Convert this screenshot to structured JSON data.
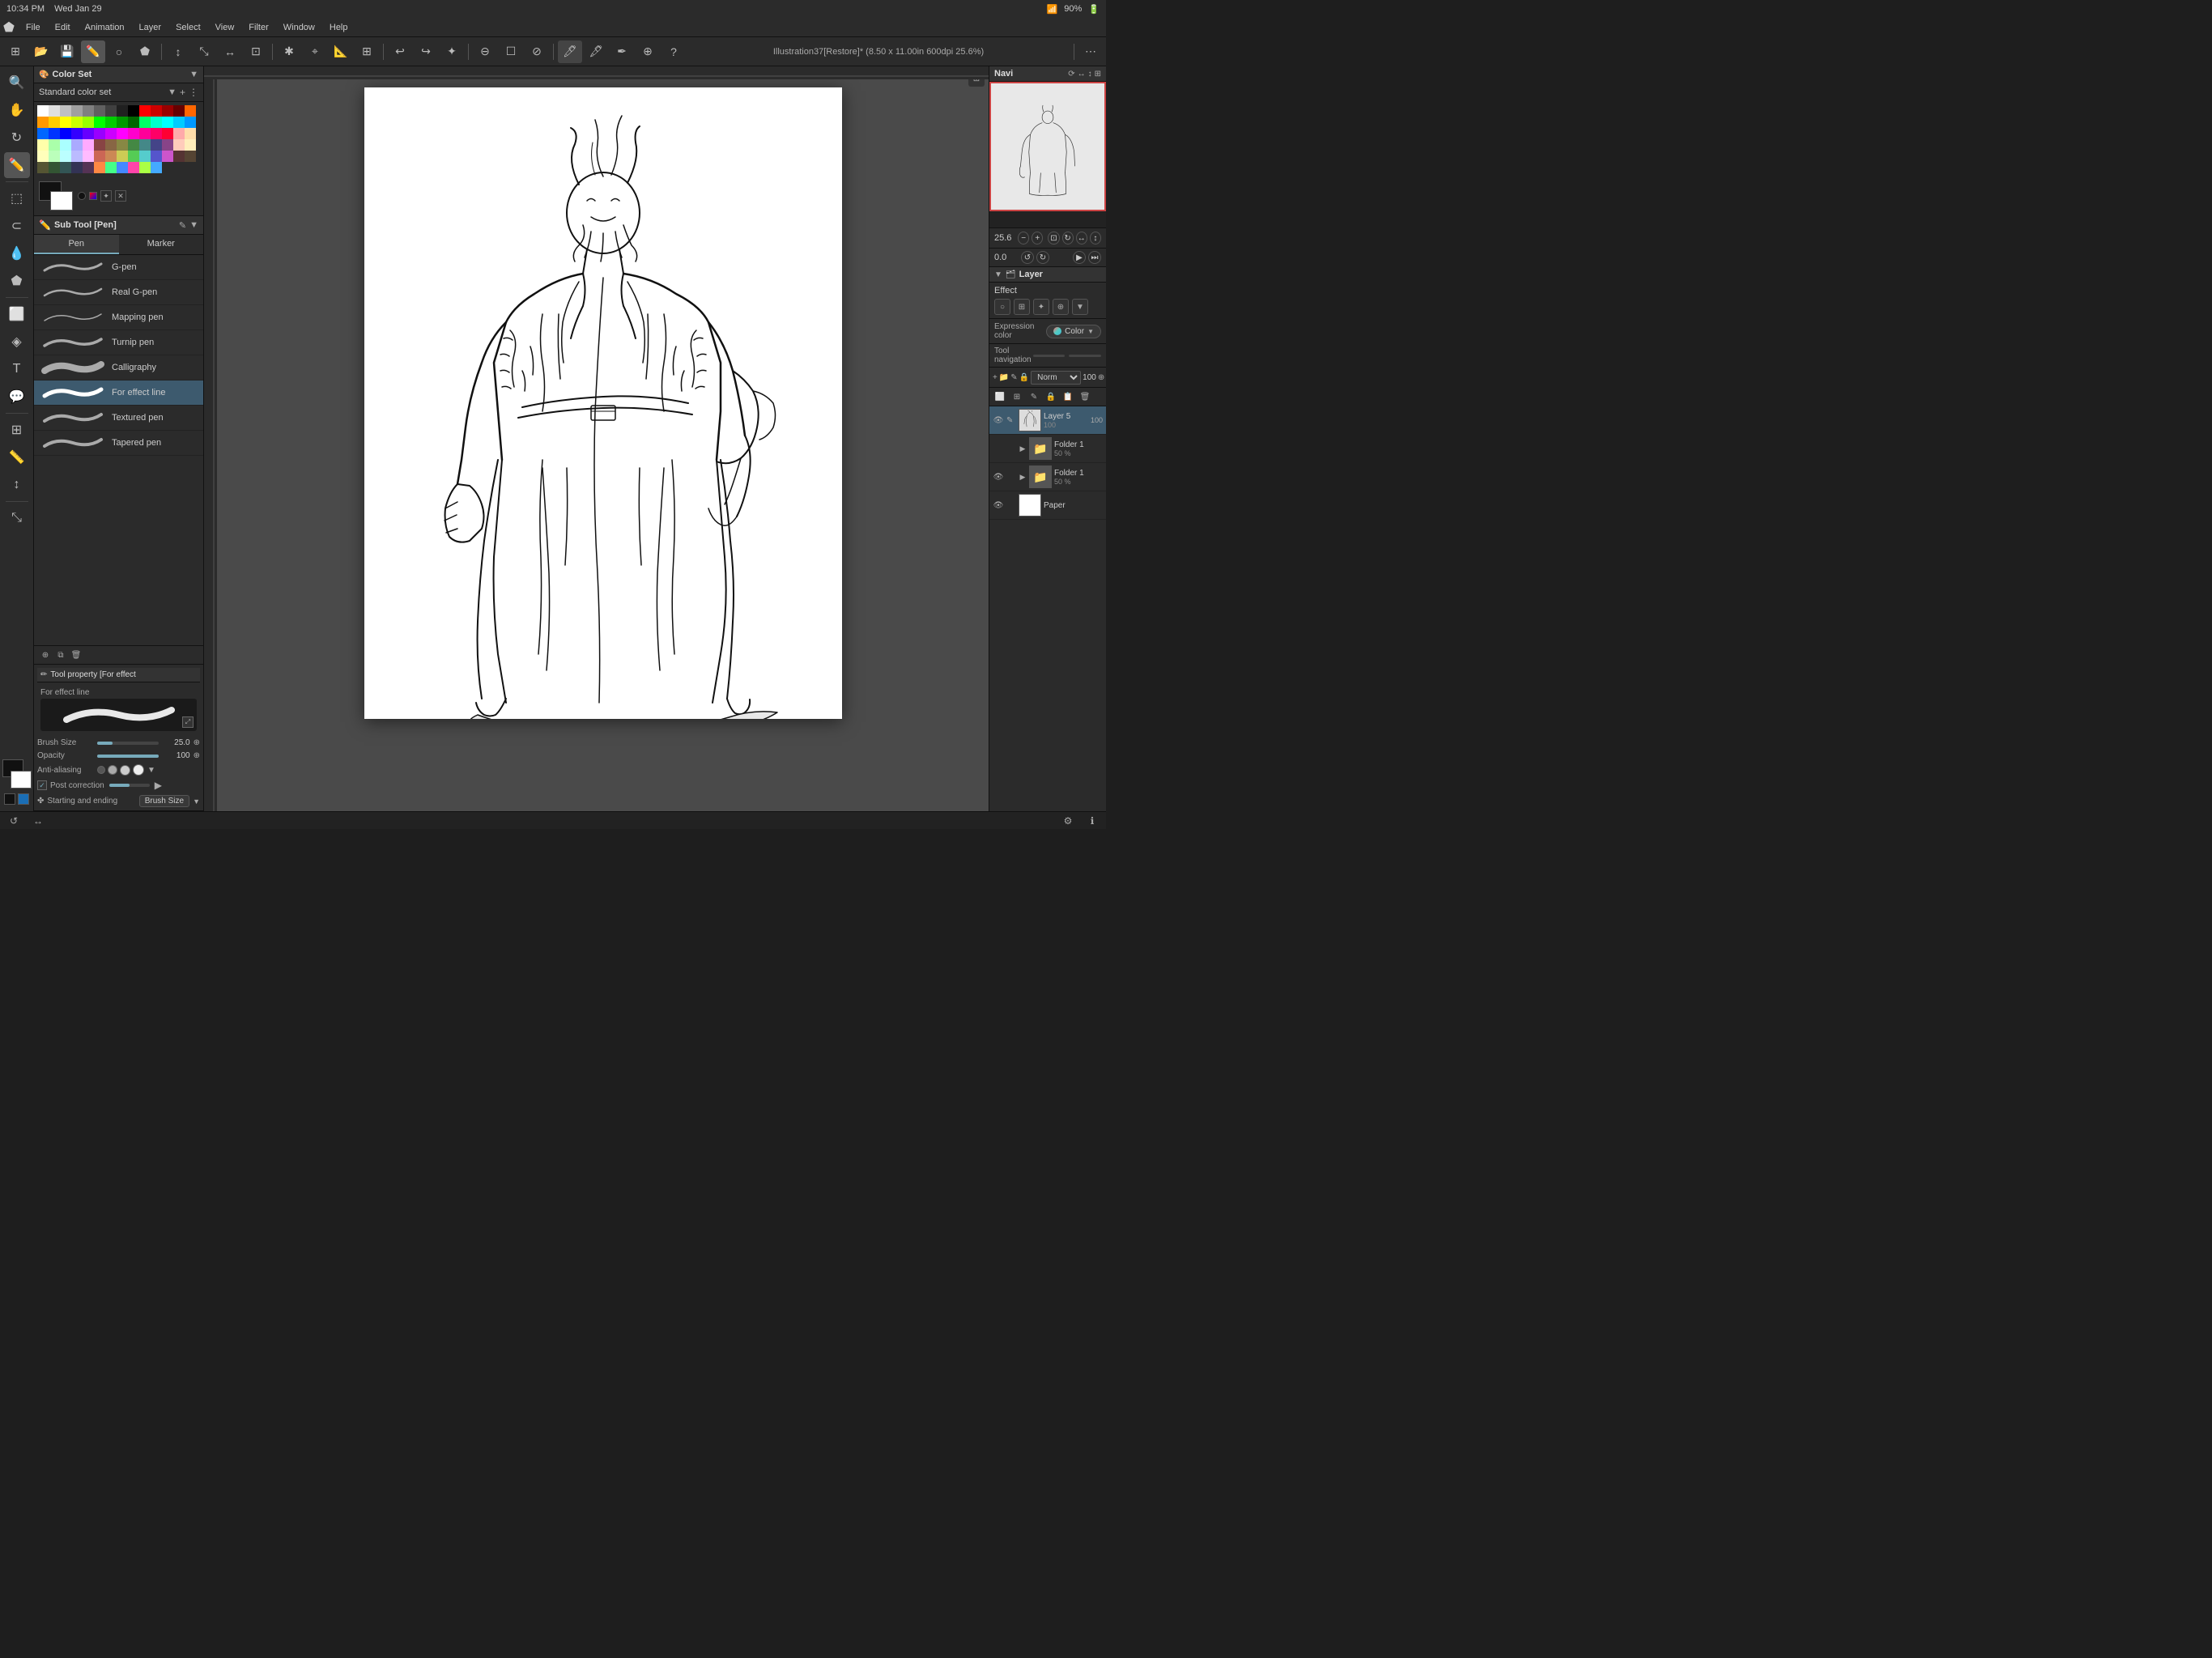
{
  "app": {
    "time": "10:34 PM",
    "day": "Wed Jan 29",
    "wifi": "90%",
    "title": "Illustration37[Restore]* (8.50 x 11.00in 600dpi 25.6%)"
  },
  "menu": {
    "items": [
      "File",
      "Edit",
      "Animation",
      "Layer",
      "Select",
      "View",
      "Filter",
      "Window",
      "Help"
    ]
  },
  "color_panel": {
    "title": "Color Set",
    "standard_label": "Standard color set",
    "swatches": [
      "#ffffff",
      "#e0e0e0",
      "#c0c0c0",
      "#a0a0a0",
      "#808080",
      "#606060",
      "#404040",
      "#202020",
      "#000000",
      "#ff0000",
      "#cc0000",
      "#990000",
      "#660000",
      "#ff6600",
      "#ff9900",
      "#ffcc00",
      "#ffff00",
      "#ccff00",
      "#99ff00",
      "#00ff00",
      "#00cc00",
      "#009900",
      "#006600",
      "#00ff66",
      "#00ffcc",
      "#00ffff",
      "#00ccff",
      "#0099ff",
      "#0066ff",
      "#0033ff",
      "#0000ff",
      "#3300ff",
      "#6600ff",
      "#9900ff",
      "#cc00ff",
      "#ff00ff",
      "#ff00cc",
      "#ff0099",
      "#ff0066",
      "#ff0033",
      "#ffaaaa",
      "#ffddaa",
      "#ffffaa",
      "#aaffaa",
      "#aaffff",
      "#aaaaff",
      "#ffaaff",
      "#884444",
      "#886644",
      "#888844",
      "#448844",
      "#448888",
      "#444488",
      "#884488",
      "#ffccbb",
      "#ffeebb",
      "#ffffbb",
      "#bbffbb",
      "#bbffff",
      "#bbbbff",
      "#ffbbff",
      "#cc6655",
      "#cc8855",
      "#cccc55",
      "#55cc55",
      "#55cccc",
      "#5555cc",
      "#cc55cc",
      "#553333",
      "#554433",
      "#555533",
      "#335533",
      "#335555",
      "#333355",
      "#553355",
      "#ff8844",
      "#44ff88",
      "#4488ff",
      "#ff44aa",
      "#aaff44",
      "#44aaff"
    ]
  },
  "subtool": {
    "header_label": "Sub Tool [Pen]",
    "tabs": [
      "Pen",
      "Marker"
    ],
    "active_tab": "Pen",
    "items": [
      {
        "name": "G-pen",
        "active": false
      },
      {
        "name": "Real G-pen",
        "active": false
      },
      {
        "name": "Mapping pen",
        "active": false
      },
      {
        "name": "Turnip pen",
        "active": false
      },
      {
        "name": "Calligraphy",
        "active": false
      },
      {
        "name": "For effect line",
        "active": true
      },
      {
        "name": "Textured pen",
        "active": false
      },
      {
        "name": "Tapered pen",
        "active": false
      }
    ]
  },
  "tool_property": {
    "header_label": "Tool property [For effect",
    "preview_label": "For effect line",
    "brush_size_label": "Brush Size",
    "brush_size_value": "25.0",
    "opacity_label": "Opacity",
    "opacity_value": "100",
    "anti_alias_label": "Anti-aliasing",
    "post_correction_label": "Post correction",
    "post_correction_checked": true,
    "starting_ending_label": "Starting and ending",
    "brush_size_dropdown": "Brush Size"
  },
  "navigator": {
    "label": "Navi",
    "zoom_value": "25.6",
    "rotate_value": "0.0"
  },
  "layers": {
    "header_label": "Layer",
    "effect_label": "Effect",
    "expression_color_label": "Expression color",
    "expression_color_value": "Color",
    "tool_navigation_label": "Tool navigation",
    "blend_mode": "Norm",
    "opacity": "100",
    "items": [
      {
        "name": "Layer 5",
        "opacity": "100",
        "type": "layer",
        "active": true,
        "visible": true
      },
      {
        "name": "Folder 1",
        "opacity": "50 %",
        "type": "folder",
        "active": false,
        "visible": false
      },
      {
        "name": "Folder 1",
        "opacity": "50 %",
        "type": "folder",
        "active": false,
        "visible": true
      },
      {
        "name": "Paper",
        "opacity": "",
        "type": "paper",
        "active": false,
        "visible": true
      }
    ]
  },
  "colors": {
    "accent": "#7ab",
    "active_layer": "#3d5a6e"
  }
}
